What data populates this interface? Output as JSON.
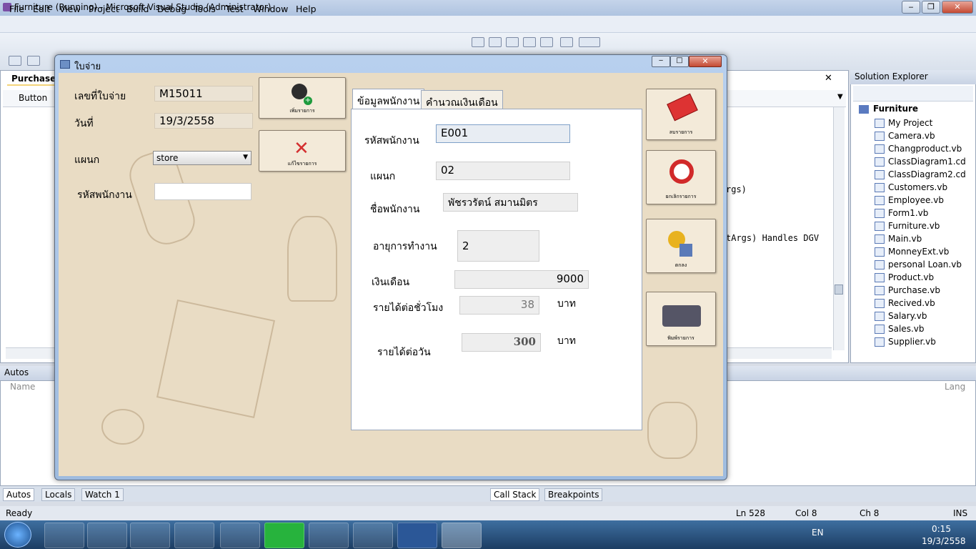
{
  "window": {
    "title": "Furniture (Running) - Microsoft Visual Studio (Administrator)"
  },
  "menu": [
    "File",
    "Edit",
    "View",
    "Project",
    "Build",
    "Debug",
    "Tools",
    "Test",
    "Window",
    "Help"
  ],
  "doc": {
    "tab": "Purchase.vb",
    "combo": "Button"
  },
  "solution": {
    "header": "Solution Explorer",
    "project": "Furniture",
    "items": [
      "My Project",
      "Camera.vb",
      "Changproduct.vb",
      "ClassDiagram1.cd",
      "ClassDiagram2.cd",
      "Customers.vb",
      "Employee.vb",
      "Form1.vb",
      "Furniture.vb",
      "Main.vb",
      "MonneyExt.vb",
      "personal Loan.vb",
      "Product.vb",
      "Purchase.vb",
      "Recived.vb",
      "Salary.vb",
      "Sales.vb",
      "Supplier.vb"
    ]
  },
  "code": {
    "frag1": "rgs)",
    "frag2": "tArgs) Handles DGV"
  },
  "autos": {
    "header": "Autos",
    "col_name": "Name",
    "col_lang": "Lang"
  },
  "bottom_tabs": {
    "autos": "Autos",
    "locals": "Locals",
    "watch": "Watch 1",
    "callstack": "Call Stack",
    "breakpoints": "Breakpoints"
  },
  "status": {
    "ready": "Ready",
    "ln": "Ln 528",
    "col": "Col 8",
    "ch": "Ch 8",
    "ins": "INS"
  },
  "tray": {
    "lang": "EN",
    "time": "0:15",
    "date": "19/3/2558"
  },
  "form": {
    "title": "ใบจ่าย",
    "labels": {
      "slip_no": "เลขที่ใบจ่าย",
      "date": "วันที่",
      "dept": "แผนก",
      "emp_id": "รหัสพนักงาน"
    },
    "values": {
      "slip_no": "M15011",
      "date": "19/3/2558",
      "dept": "store",
      "emp_id": ""
    },
    "buttons": {
      "add": "เพิ่มรายการ",
      "edit": "แก้ไขรายการ",
      "clear": "ลบรายการ",
      "cancel": "ยกเลิกรายการ",
      "ok": "ตกลง",
      "print": "พิมพ์รายการ"
    },
    "tabs": {
      "emp_info": "ข้อมูลพนักงาน",
      "salary_calc": "คำนวณเงินเดือน"
    },
    "emp": {
      "l_id": "รหัสพนักงาน",
      "v_id": "E001",
      "l_dept": "แผนก",
      "v_dept": "02",
      "l_name": "ชื่อพนักงาน",
      "v_name": "พัชรวรัตน์ สมานมิตร",
      "l_age": "อายุการทำงาน",
      "v_age": "2",
      "l_salary": "เงินเดือน",
      "v_salary": "9000",
      "l_hourly": "รายได้ต่อชั่วโมง",
      "v_hourly": "38",
      "l_daily": "รายได้ต่อวัน",
      "v_daily": "300",
      "unit": "บาท"
    }
  }
}
